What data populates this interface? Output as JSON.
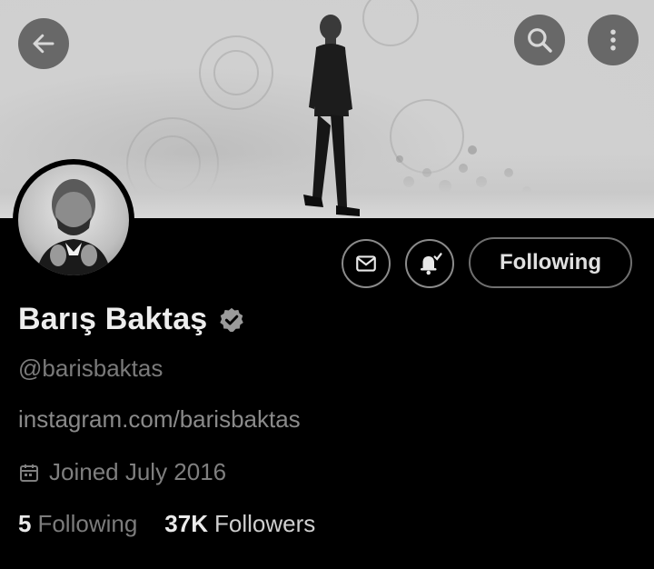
{
  "header": {
    "back_icon": "arrow-left-icon",
    "search_icon": "search-icon",
    "more_icon": "more-vertical-icon"
  },
  "profile": {
    "display_name": "Barış Baktaş",
    "verified_icon": "verified-badge-icon",
    "handle": "@barisbaktas",
    "website": "instagram.com/barisbaktas",
    "joined_icon": "calendar-icon",
    "joined": "Joined July 2016",
    "following_count": "5",
    "following_label": "Following",
    "followers_count": "37K",
    "followers_label": "Followers"
  },
  "actions": {
    "message_icon": "envelope-icon",
    "notifications_icon": "bell-check-icon",
    "follow_button_label": "Following"
  },
  "colors": {
    "background": "#000000",
    "text_primary": "#e7e9ea",
    "text_secondary": "#7a7a7a",
    "button_border": "#6f6f6f"
  }
}
